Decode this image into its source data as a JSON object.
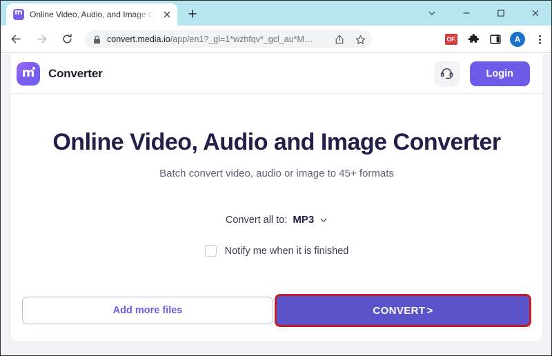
{
  "browser": {
    "tab": {
      "title": "Online Video, Audio, and Image C",
      "favicon": "media-io-logo-icon",
      "close": "close-icon"
    },
    "new_tab_label": "+",
    "window_controls": {
      "tab_search": "chevron-down-icon",
      "minimize": "minimize-icon",
      "maximize": "maximize-icon",
      "close": "close-icon"
    },
    "nav": {
      "back": "back-arrow-icon",
      "forward": "forward-arrow-icon",
      "reload": "reload-icon"
    },
    "omnibox": {
      "lock": "lock-icon",
      "url_domain": "convert.media.io",
      "url_path": "/app/en1?_gl=1*wzhfqv*_gcl_au*M…",
      "share": "share-icon",
      "bookmark": "star-icon"
    },
    "toolbar_right": {
      "extension_badge": "OF.",
      "extensions": "puzzle-piece-icon",
      "side_panel": "side-panel-icon",
      "profile_initial": "A",
      "menu": "three-dot-menu-icon"
    },
    "colors": {
      "tabstrip": "#b8e6f0",
      "omnibox": "#f1f3f4",
      "avatar": "#1a73c8",
      "ext_badge": "#d93b3b"
    }
  },
  "site": {
    "header": {
      "logo": "media-io-logo-icon",
      "logo_letter": "m",
      "brand": "Converter",
      "support_icon": "headset-icon",
      "login_label": "Login"
    },
    "hero": {
      "title": "Online Video, Audio and Image Converter",
      "subtitle": "Batch convert video, audio or image to 45+ formats"
    },
    "controls": {
      "convert_all_label": "Convert all to:",
      "selected_format": "MP3",
      "format_options": [
        "MP3"
      ],
      "dropdown_icon": "chevron-down-icon",
      "notify_label": "Notify me when it is finished",
      "notify_checked": false
    },
    "actions": {
      "add_more_label": "Add more files",
      "convert_label": "CONVERT",
      "convert_arrow": ">"
    },
    "colors": {
      "accent": "#6c5ce7",
      "convert_button": "#5a53c9",
      "heading": "#221f49",
      "highlight_box": "#c21f2b"
    }
  }
}
